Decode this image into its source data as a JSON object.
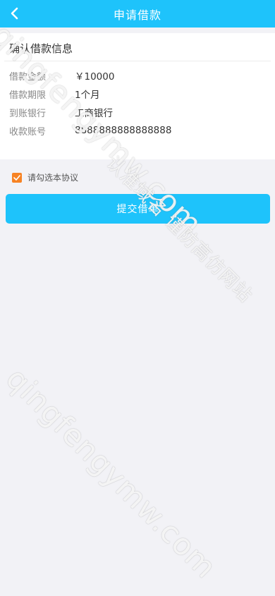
{
  "header": {
    "title": "申请借款",
    "back_icon": "chevron-left-icon",
    "color": "#1ec3fb"
  },
  "confirm_card": {
    "title": "确认借款信息",
    "rows": [
      {
        "label": "借款金额",
        "value": "￥10000"
      },
      {
        "label": "借款期限",
        "value": "1个月"
      },
      {
        "label": "到账银行",
        "value": "工商银行"
      },
      {
        "label": "收款账号",
        "value": "8888888888888888"
      }
    ]
  },
  "agreement": {
    "label": "请勾选本协议",
    "checked": true,
    "checkbox_color": "#f78324"
  },
  "submit_button": {
    "label": "提交借单"
  },
  "watermarks": {
    "top": "qingfengymw.com",
    "middle": "认准域名 谨防高仿网站",
    "bottom": "qingfengymw.com"
  }
}
